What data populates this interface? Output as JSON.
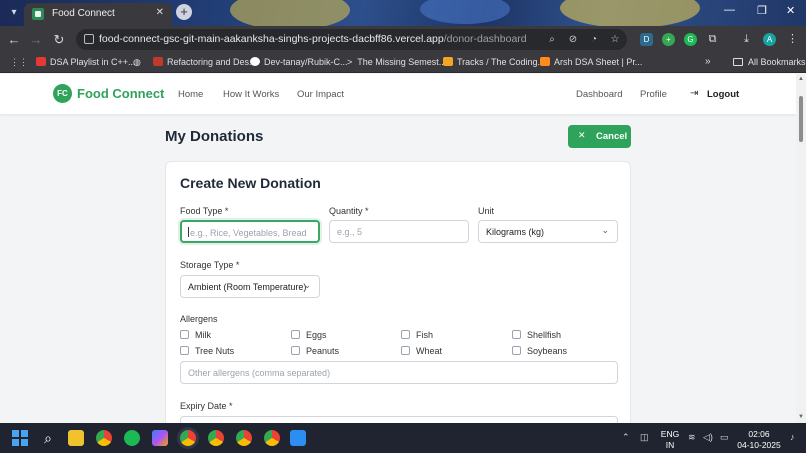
{
  "browser": {
    "tab_title": "Food Connect",
    "tab_close": "✕",
    "new_tab": "+",
    "url_host": "food-connect-gsc-git-main-aakanksha-singhs-projects-dacbff86.vercel.app",
    "url_path": "/donor-dashboard",
    "profile_initial": "A",
    "all_bookmarks": "All Bookmarks",
    "bookmarks_more": "»",
    "bookmarks": [
      {
        "label": "DSA Playlist in C++...",
        "color": "#e53935"
      },
      {
        "label": "Refactoring and Des...",
        "color": "#c0392b"
      },
      {
        "label": "Dev-tanay/Rubik-C...",
        "color": "#ffffff"
      },
      {
        "label": "The Missing Semest...",
        "color": "#dddddd"
      },
      {
        "label": "Tracks / The Coding...",
        "color": "#f4a623"
      },
      {
        "label": "Arsh DSA Sheet | Pr...",
        "color": "#ff8c1a"
      }
    ]
  },
  "site": {
    "logo_initials": "FC",
    "brand": "Food Connect",
    "nav": {
      "home": "Home",
      "how": "How It Works",
      "impact": "Our Impact",
      "dashboard": "Dashboard",
      "profile": "Profile",
      "logout": "Logout"
    }
  },
  "main": {
    "page_title": "My Donations",
    "cancel_label": "Cancel",
    "form": {
      "title": "Create New Donation",
      "food_type_label": "Food Type *",
      "food_type_placeholder": "e.g., Rice, Vegetables, Bread",
      "quantity_label": "Quantity *",
      "quantity_placeholder": "e.g., 5",
      "unit_label": "Unit",
      "unit_value": "Kilograms (kg)",
      "storage_label": "Storage Type *",
      "storage_value": "Ambient (Room Temperature)",
      "allergens_label": "Allergens",
      "allergens": [
        "Milk",
        "Eggs",
        "Fish",
        "Shellfish",
        "Tree Nuts",
        "Peanuts",
        "Wheat",
        "Soybeans"
      ],
      "other_allergens_placeholder": "Other allergens (comma separated)",
      "expiry_label": "Expiry Date *"
    }
  },
  "taskbar": {
    "lang_top": "ENG",
    "lang_bottom": "IN",
    "time": "02:06",
    "date": "04-10-2025"
  },
  "colors": {
    "brand_green": "#2fa35b",
    "focus_green": "#3aa864"
  }
}
